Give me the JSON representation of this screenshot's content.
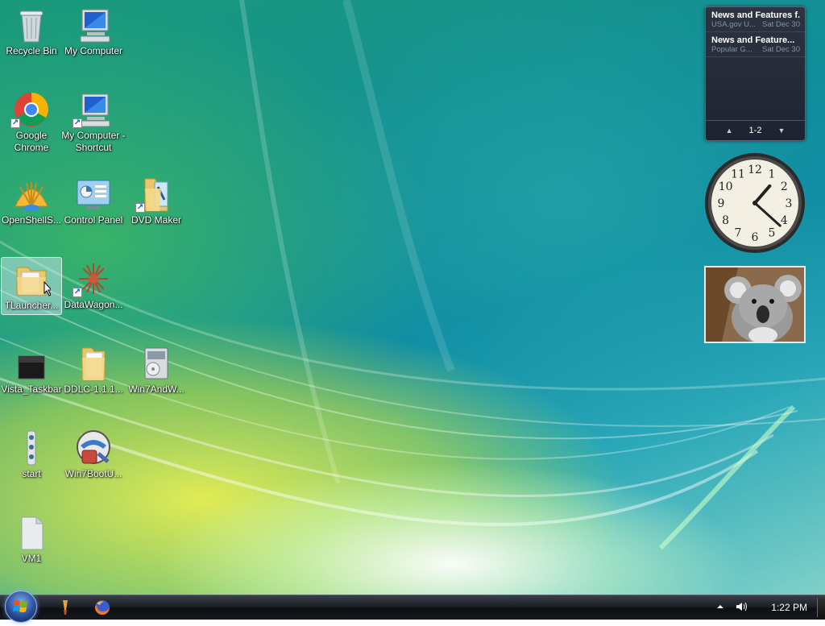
{
  "desktop_icons": [
    {
      "label": "Recycle Bin",
      "icon": "recycle-bin-icon",
      "shortcut": false
    },
    {
      "label": "My Computer",
      "icon": "computer-icon",
      "shortcut": false
    },
    {
      "label": "Google Chrome",
      "icon": "chrome-icon",
      "shortcut": true
    },
    {
      "label": "My Computer - Shortcut",
      "icon": "computer-icon",
      "shortcut": true
    },
    {
      "label": "OpenShellS...",
      "icon": "shell-icon",
      "shortcut": false
    },
    {
      "label": "Control Panel",
      "icon": "control-panel-icon",
      "shortcut": false
    },
    {
      "label": "DVD Maker",
      "icon": "dvd-maker-icon",
      "shortcut": true
    },
    {
      "label": "TLauncher...",
      "icon": "folder-icon",
      "shortcut": false,
      "selected": true
    },
    {
      "label": "DataWagon...",
      "icon": "datawagon-icon",
      "shortcut": true
    },
    {
      "label": "Vista_Taskbar",
      "icon": "black-file-icon",
      "shortcut": false
    },
    {
      "label": "DDLC-1.1.1...",
      "icon": "folder-icon",
      "shortcut": false
    },
    {
      "label": "Win7AndW...",
      "icon": "installer-icon",
      "shortcut": false
    },
    {
      "label": "start",
      "icon": "batch-file-icon",
      "shortcut": false
    },
    {
      "label": "Win7BootU...",
      "icon": "boot-updater-icon",
      "shortcut": false
    },
    {
      "label": "VM1",
      "icon": "file-icon",
      "shortcut": false
    }
  ],
  "feed_gadget": {
    "items": [
      {
        "title": "News and Features f...",
        "source": "USA.gov U...",
        "date": "Sat Dec 30"
      },
      {
        "title": "News and Feature...",
        "source": "Popular G...",
        "date": "Sat Dec 30"
      }
    ],
    "page": "1-2"
  },
  "clock_gadget": {
    "numerals": [
      "12",
      "1",
      "2",
      "3",
      "4",
      "5",
      "6",
      "7",
      "8",
      "9",
      "10",
      "11"
    ],
    "hour": 1,
    "minute": 22
  },
  "photo_gadget": {
    "subject": "koala"
  },
  "taskbar": {
    "clock": "1:22 PM",
    "quick_launch": [
      "paint-icon",
      "firefox-icon"
    ],
    "tray_icons": [
      "show-hidden-icon",
      "volume-icon"
    ]
  },
  "colors": {
    "taskbar": "#15181d",
    "gadget_bg": "#252b38",
    "selection": "#dcebfa"
  }
}
